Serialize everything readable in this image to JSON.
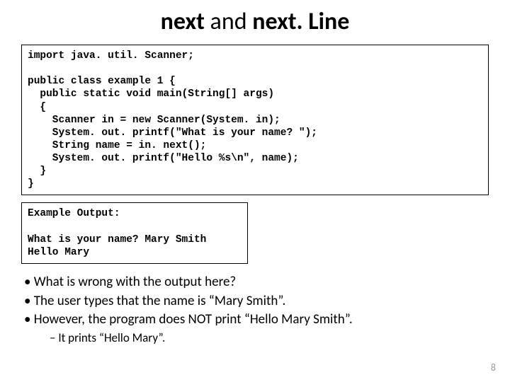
{
  "title": {
    "part1_bold": "next",
    "part2_reg": " and ",
    "part3_bold": "next. Line"
  },
  "code": "import java. util. Scanner;\n\npublic class example 1 {\n  public static void main(String[] args)\n  {\n    Scanner in = new Scanner(System. in);\n    System. out. printf(\"What is your name? \");\n    String name = in. next();\n    System. out. printf(\"Hello %s\\n\", name);\n  }\n}",
  "output": "Example Output:\n\nWhat is your name? Mary Smith\nHello Mary",
  "bullets": {
    "b1": "What is wrong with the output here?",
    "b2": "The user types that the name is “Mary Smith”.",
    "b3": "However, the program does NOT print “Hello Mary Smith”.",
    "sub1": "It prints “Hello Mary”."
  },
  "page_number": "8"
}
